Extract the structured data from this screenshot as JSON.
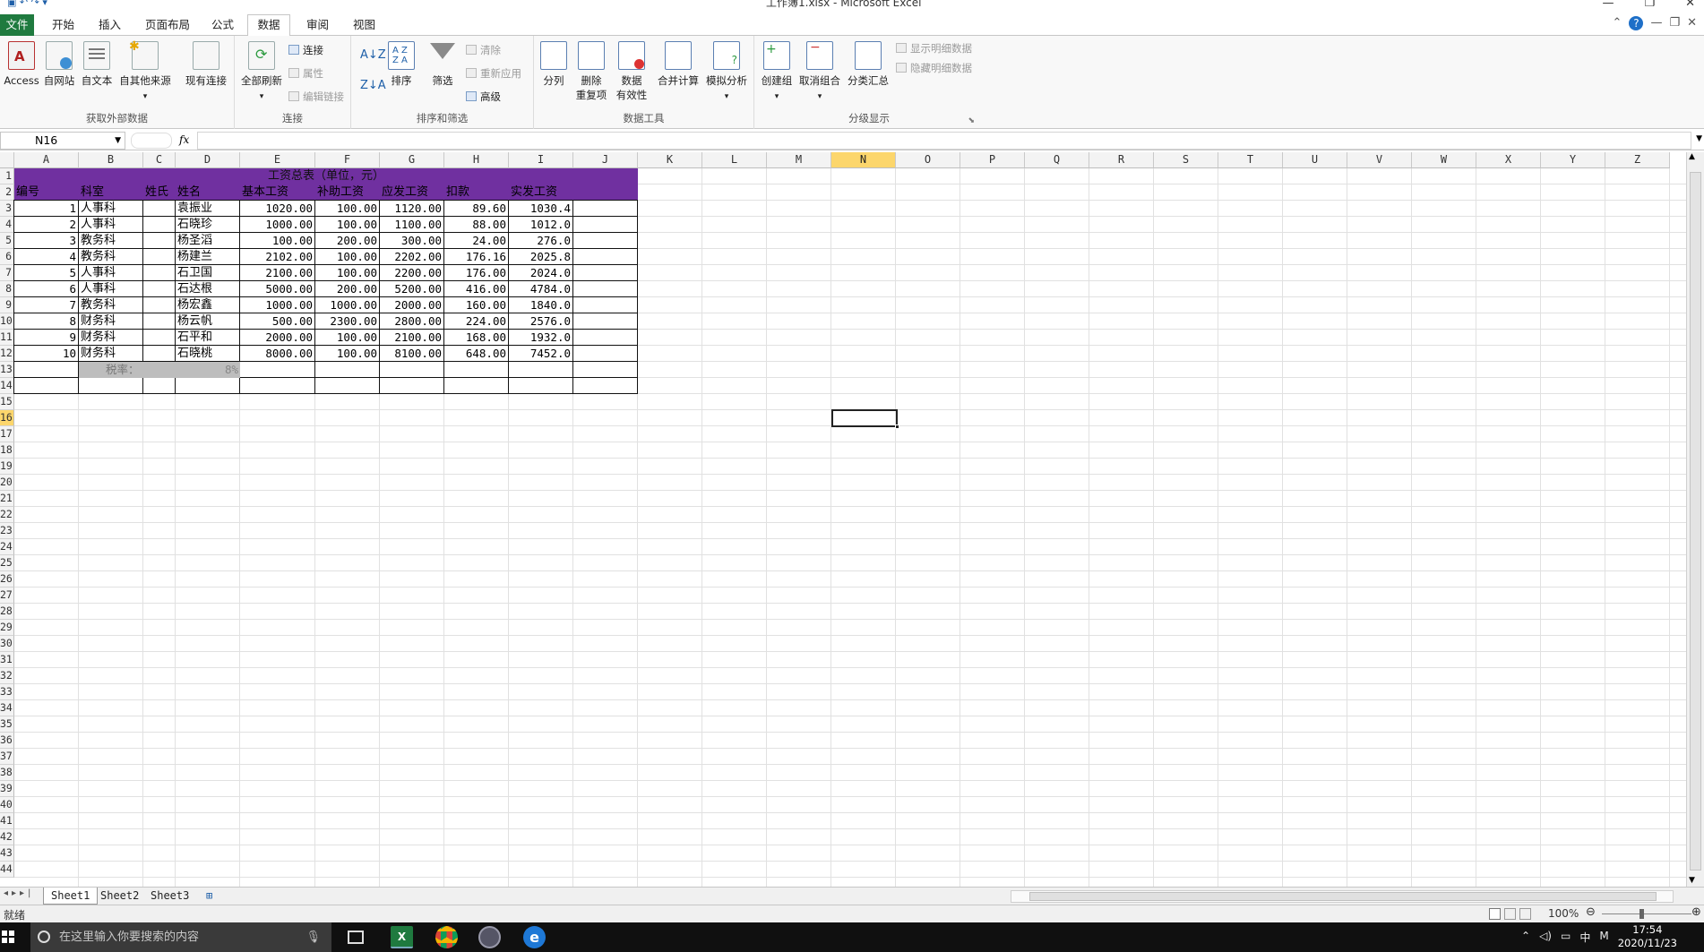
{
  "window": {
    "title": "工作簿1.xlsx - Microsoft Excel"
  },
  "tabs": [
    "文件",
    "开始",
    "插入",
    "页面布局",
    "公式",
    "数据",
    "审阅",
    "视图"
  ],
  "ribbon": {
    "groups": [
      {
        "label": "获取外部数据",
        "buttons": [
          "Access",
          "自网站",
          "自文本",
          "自其他来源",
          "现有连接"
        ]
      },
      {
        "label": "连接",
        "buttons": [
          "全部刷新",
          "连接",
          "属性",
          "编辑链接"
        ]
      },
      {
        "label": "排序和筛选",
        "buttons": [
          "排序",
          "筛选",
          "清除",
          "重新应用",
          "高级"
        ]
      },
      {
        "label": "数据工具",
        "buttons": [
          "分列",
          "删除",
          "重复项",
          "数据",
          "有效性",
          "合并计算",
          "模拟分析"
        ]
      },
      {
        "label": "分级显示",
        "buttons": [
          "创建组",
          "取消组合",
          "分类汇总",
          "显示明细数据",
          "隐藏明细数据"
        ]
      }
    ]
  },
  "formula_bar": {
    "name_box": "N16",
    "fx": "fx",
    "formula": ""
  },
  "columns": [
    "A",
    "B",
    "C",
    "D",
    "E",
    "F",
    "G",
    "H",
    "I",
    "J",
    "K",
    "L",
    "M",
    "N",
    "O",
    "P",
    "Q",
    "R",
    "S",
    "T",
    "U",
    "V",
    "W",
    "X",
    "Y",
    "Z"
  ],
  "rows": [
    "1",
    "2",
    "3",
    "4",
    "5",
    "6",
    "7",
    "8",
    "9",
    "10",
    "11",
    "12",
    "13",
    "14",
    "15",
    "16",
    "17",
    "18",
    "19",
    "20",
    "21",
    "22",
    "23",
    "24",
    "25",
    "26",
    "27",
    "28",
    "29",
    "30",
    "31",
    "32",
    "33",
    "34",
    "35",
    "36",
    "37",
    "38",
    "39",
    "40",
    "41",
    "42",
    "43",
    "44"
  ],
  "sheet": {
    "title": "工资总表（单位，元）",
    "headers": [
      "编号",
      "科室",
      "姓氏",
      "姓名",
      "基本工资",
      "补助工资",
      "应发工资",
      "扣款",
      "实发工资"
    ],
    "data": [
      [
        "1",
        "人事科",
        "",
        "袁振业",
        "1020.00",
        "100.00",
        "1120.00",
        "89.60",
        "1030.4"
      ],
      [
        "2",
        "人事科",
        "",
        "石晓珍",
        "1000.00",
        "100.00",
        "1100.00",
        "88.00",
        "1012.0"
      ],
      [
        "3",
        "教务科",
        "",
        "杨圣滔",
        "100.00",
        "200.00",
        "300.00",
        "24.00",
        "276.0"
      ],
      [
        "4",
        "教务科",
        "",
        "杨建兰",
        "2102.00",
        "100.00",
        "2202.00",
        "176.16",
        "2025.8"
      ],
      [
        "5",
        "人事科",
        "",
        "石卫国",
        "2100.00",
        "100.00",
        "2200.00",
        "176.00",
        "2024.0"
      ],
      [
        "6",
        "人事科",
        "",
        "石达根",
        "5000.00",
        "200.00",
        "5200.00",
        "416.00",
        "4784.0"
      ],
      [
        "7",
        "教务科",
        "",
        "杨宏鑫",
        "1000.00",
        "1000.00",
        "2000.00",
        "160.00",
        "1840.0"
      ],
      [
        "8",
        "财务科",
        "",
        "杨云帆",
        "500.00",
        "2300.00",
        "2800.00",
        "224.00",
        "2576.0"
      ],
      [
        "9",
        "财务科",
        "",
        "石平和",
        "2000.00",
        "100.00",
        "2100.00",
        "168.00",
        "1932.0"
      ],
      [
        "10",
        "财务科",
        "",
        "石晓桃",
        "8000.00",
        "100.00",
        "8100.00",
        "648.00",
        "7452.0"
      ]
    ],
    "tax_label": "税率：",
    "tax_value": "8%"
  },
  "sheet_tabs": [
    "Sheet1",
    "Sheet2",
    "Sheet3"
  ],
  "status": {
    "ready": "就绪",
    "zoom": "100%"
  },
  "taskbar": {
    "search_placeholder": "在这里输入你要搜索的内容",
    "ime": "中",
    "ime2": "M",
    "time": "17:54",
    "date": "2020/11/23"
  },
  "colors": {
    "header_purple": "#7030a0",
    "excel_green": "#1f7a3f",
    "selection_yellow": "#fcd66c"
  }
}
